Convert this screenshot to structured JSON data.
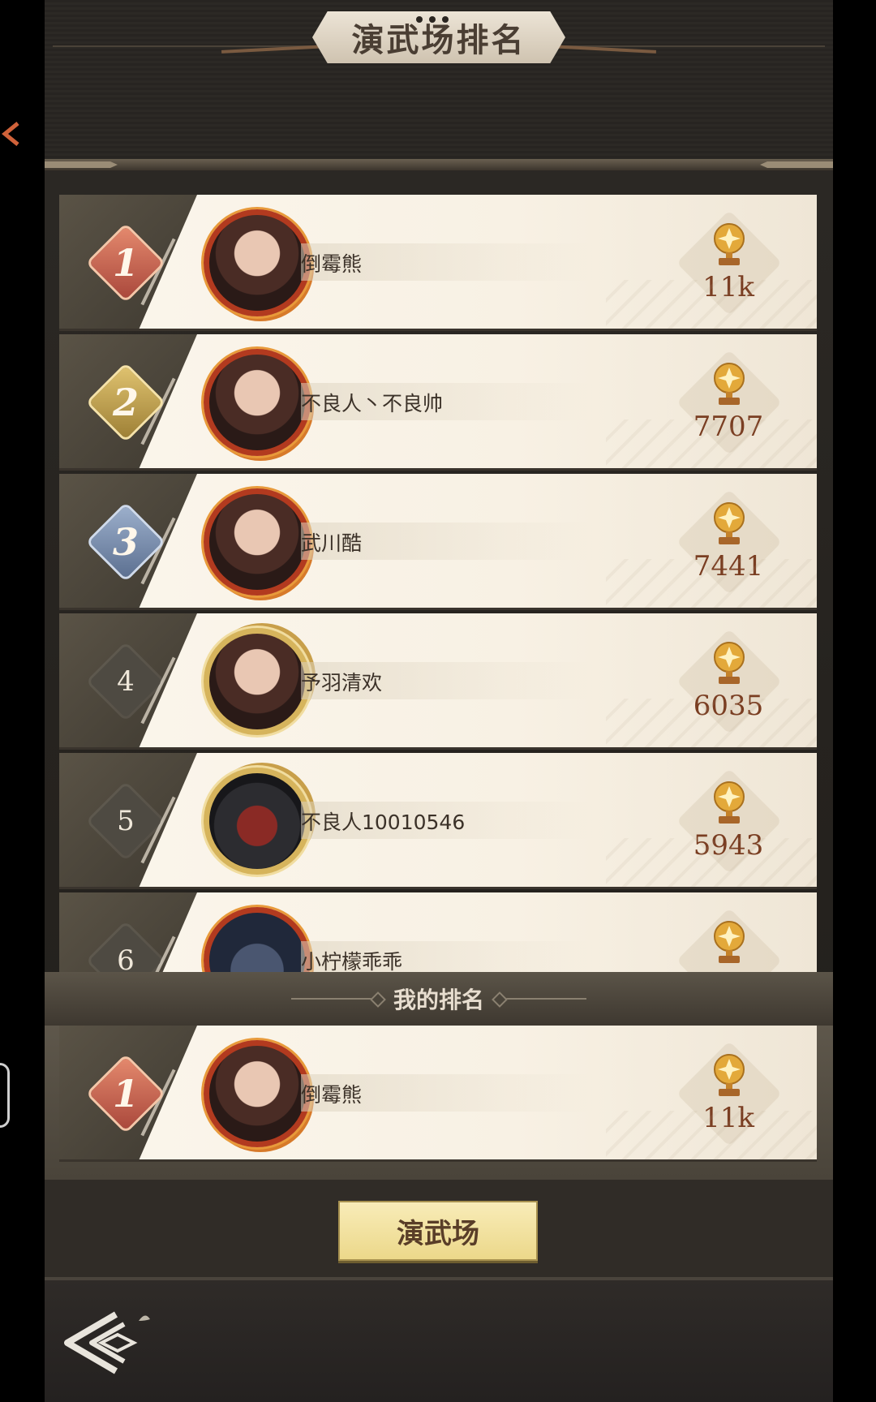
{
  "header": {
    "title": "演武场排名"
  },
  "ranking": [
    {
      "rank": "1",
      "name": "倒霉熊",
      "score": "11k"
    },
    {
      "rank": "2",
      "name": "不良人丶不良帅",
      "score": "7707"
    },
    {
      "rank": "3",
      "name": "武川酷",
      "score": "7441"
    },
    {
      "rank": "4",
      "name": "予羽清欢",
      "score": "6035"
    },
    {
      "rank": "5",
      "name": "不良人10010546",
      "score": "5943"
    },
    {
      "rank": "6",
      "name": "小柠檬乖乖",
      "score": ""
    }
  ],
  "my_rank": {
    "label": "我的排名",
    "rank": "1",
    "name": "倒霉熊",
    "score": "11k"
  },
  "actions": {
    "arena_button": "演武场"
  },
  "icons": {
    "trophy": "trophy-icon",
    "back": "back-arrow-icon",
    "side": "chevron-left-icon"
  },
  "colors": {
    "rank1": "#c9604c",
    "rank2": "#c7a652",
    "rank3": "#7f93b3",
    "score_text": "#7a3e22",
    "button_bg": "#f2e2a0"
  }
}
